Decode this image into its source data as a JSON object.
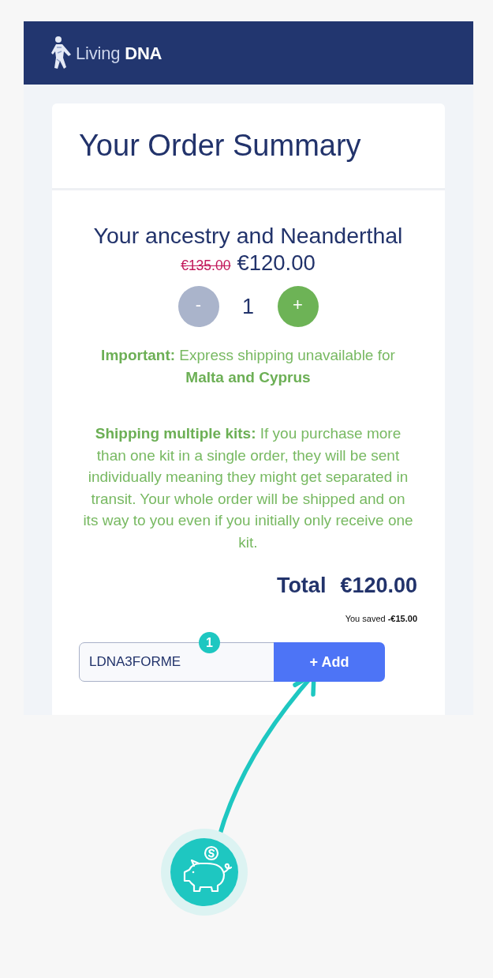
{
  "header": {
    "logo": "Living **DNA**"
  },
  "order_summary": {
    "title": "Your Order Summary",
    "product": {
      "name": "Your ancestry and Neanderthal",
      "original_price": "€135.00",
      "price": "€120.00",
      "quantity": {
        "minus": {
          "label": "-",
          "disabled": true
        },
        "value": "1",
        "plus": {
          "label": "+",
          "disabled": false
        }
      }
    },
    "notices": [
      "**Important:** Express shipping unavailable for **Malta and Cyprus**",
      "**Shipping multiple kits:** If you purchase more than one kit in a single order, they will be sent individually meaning they might get separated in transit. Your whole order will be shipped and on its way to you even if you initially only receive one kit."
    ],
    "total": {
      "label": "Total",
      "amount": "€120.00"
    },
    "savings": "You saved **-€15.00**",
    "promo": {
      "value": "LDNA3FORME",
      "button": "+ Add"
    }
  },
  "annotation": {
    "step_number": "1"
  }
}
